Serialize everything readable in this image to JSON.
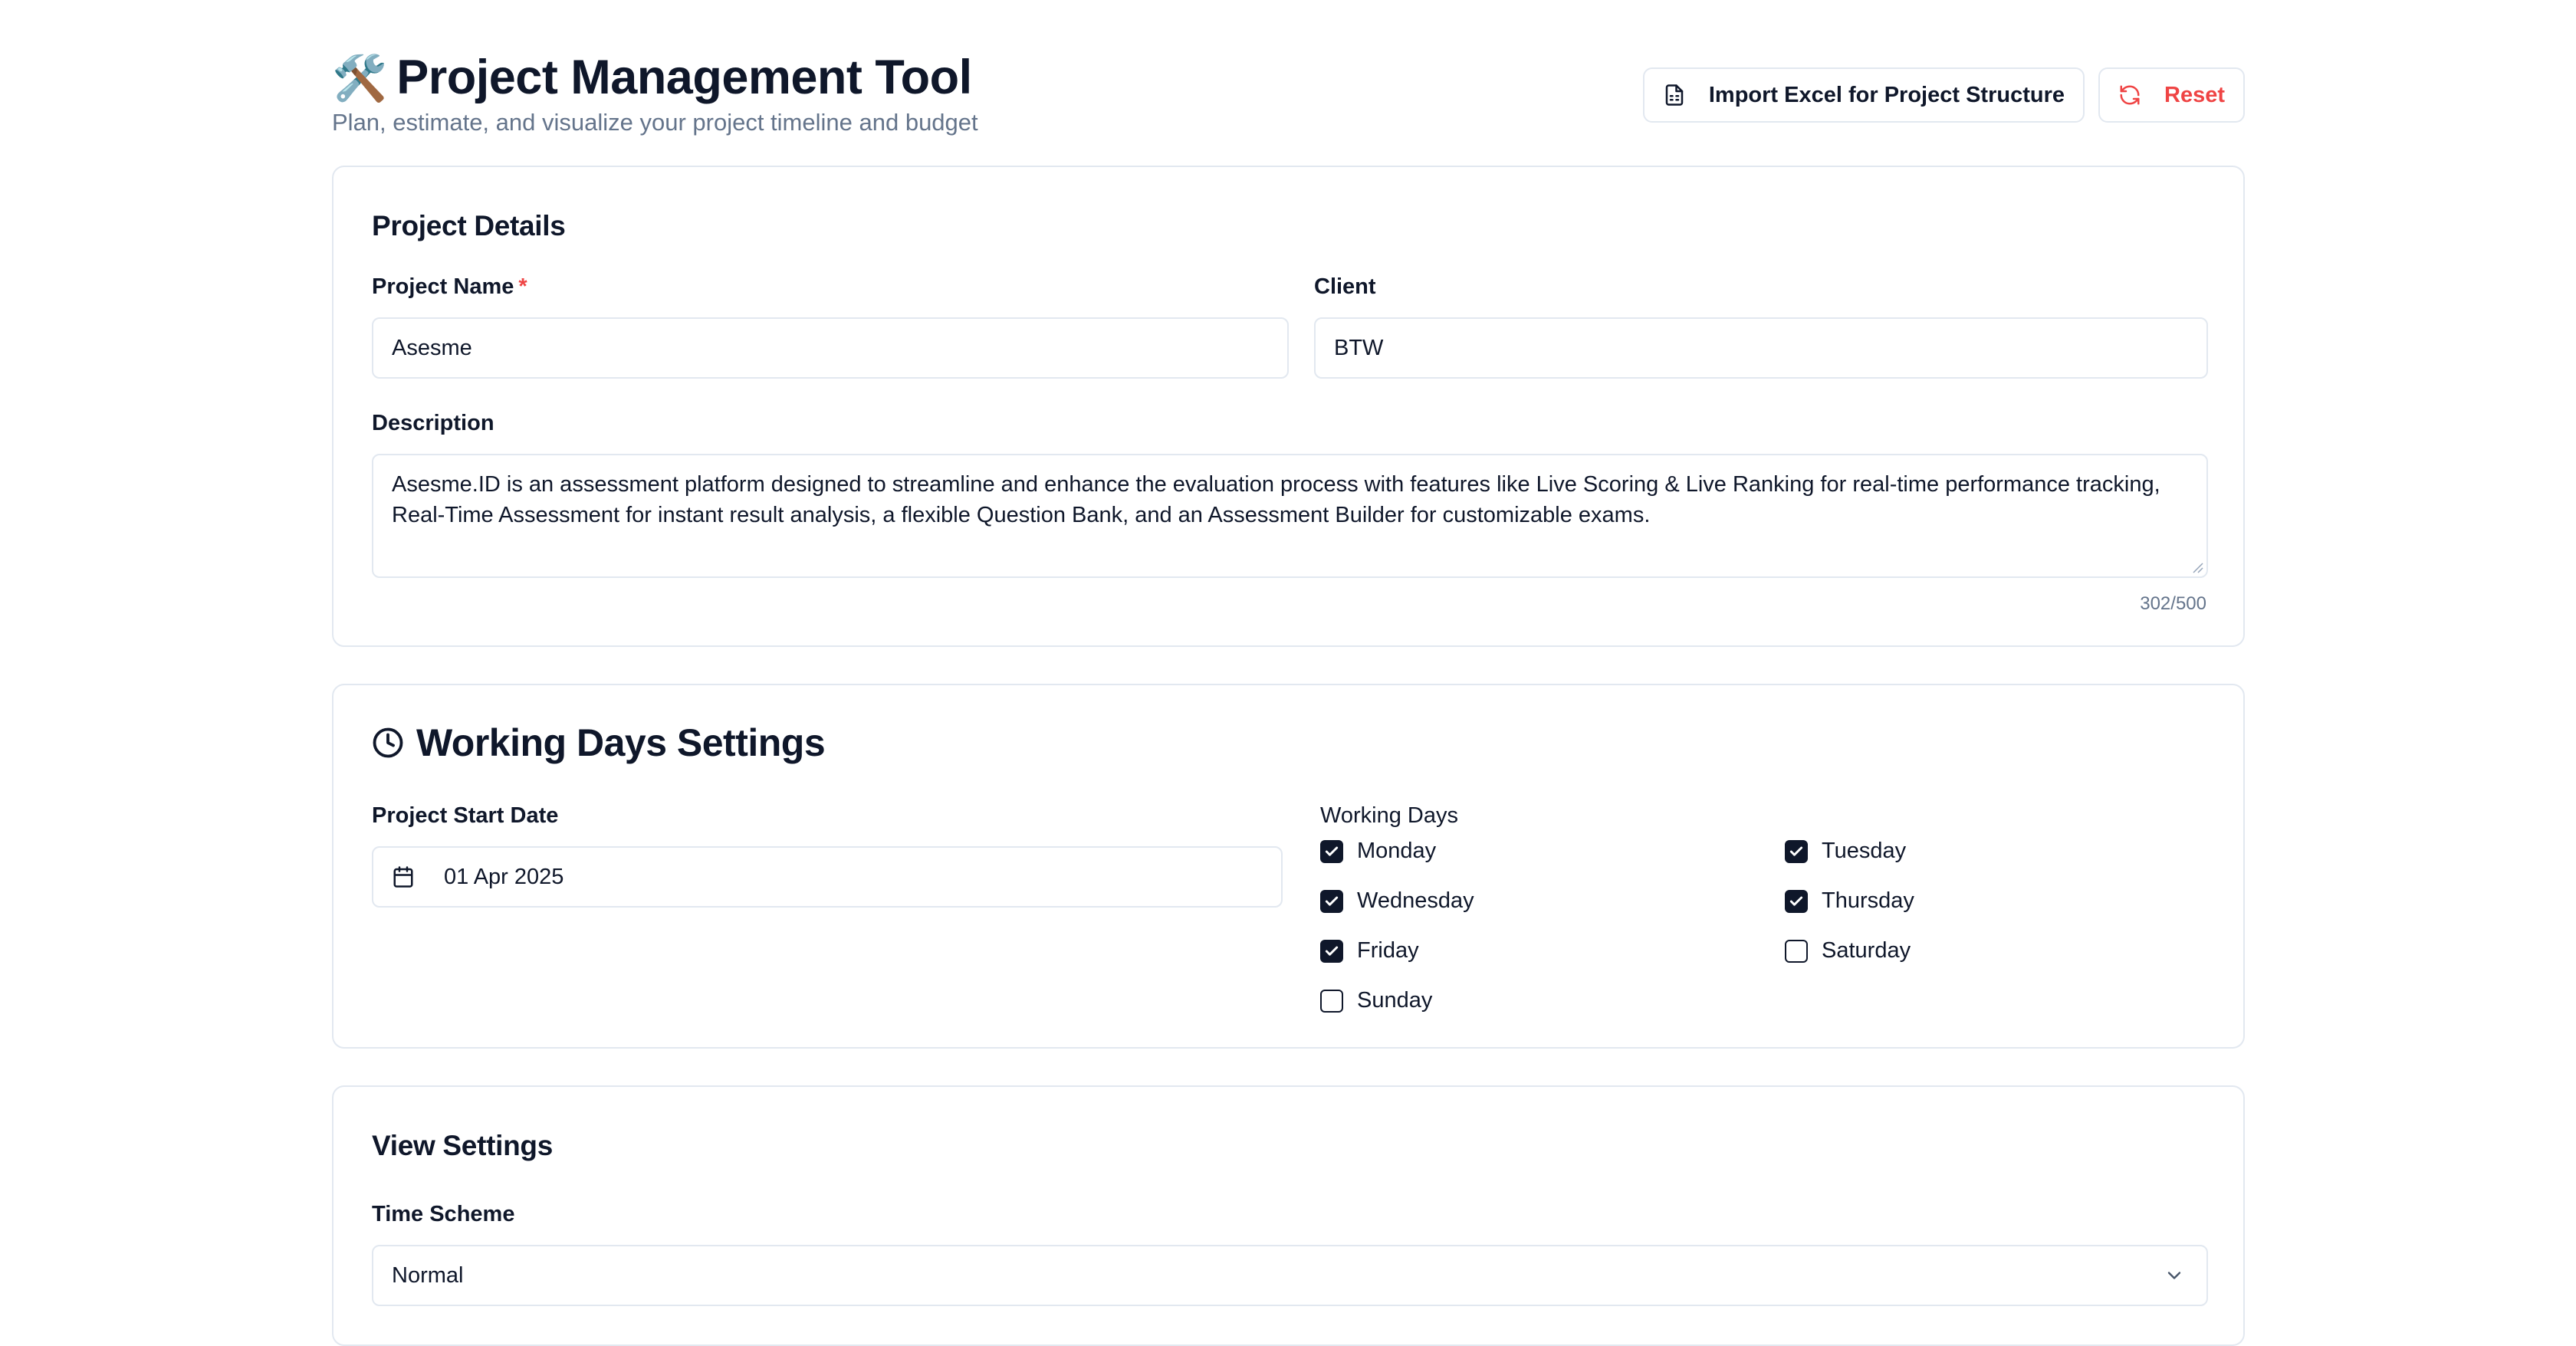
{
  "header": {
    "emoji": "🛠️",
    "title": "Project Management Tool",
    "subtitle": "Plan, estimate, and visualize your project timeline and budget",
    "import_label": "Import Excel for Project Structure",
    "reset_label": "Reset"
  },
  "project_details": {
    "title": "Project Details",
    "name_label": "Project Name",
    "required_mark": "*",
    "name_value": "Asesme",
    "client_label": "Client",
    "client_value": "BTW",
    "description_label": "Description",
    "description_value": "Asesme.ID is an assessment platform designed to streamline and enhance the evaluation process with features like Live Scoring & Live Ranking for real-time performance tracking, Real-Time Assessment for instant result analysis, a flexible Question Bank, and an Assessment Builder for customizable exams.",
    "char_count": "302/500"
  },
  "working_days": {
    "title": "Working Days Settings",
    "start_date_label": "Project Start Date",
    "start_date_value": "01 Apr 2025",
    "days_label": "Working Days",
    "days": [
      {
        "label": "Monday",
        "checked": true
      },
      {
        "label": "Tuesday",
        "checked": true
      },
      {
        "label": "Wednesday",
        "checked": true
      },
      {
        "label": "Thursday",
        "checked": true
      },
      {
        "label": "Friday",
        "checked": true
      },
      {
        "label": "Saturday",
        "checked": false
      },
      {
        "label": "Sunday",
        "checked": false
      }
    ]
  },
  "view_settings": {
    "title": "View Settings",
    "time_scheme_label": "Time Scheme",
    "time_scheme_value": "Normal"
  },
  "colors": {
    "accent": "#0f172a",
    "danger": "#ef4444",
    "muted": "#64748b",
    "border": "#e2e8f0"
  }
}
